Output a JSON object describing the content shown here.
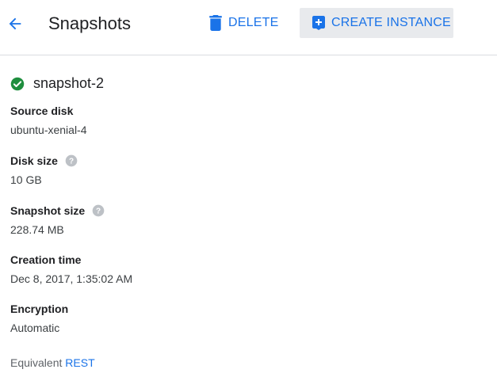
{
  "header": {
    "title": "Snapshots",
    "back_icon": "arrow-back-icon",
    "delete_label": "DELETE",
    "delete_icon": "trash-icon",
    "create_instance_label": "CREATE INSTANCE",
    "create_instance_icon": "add-box-icon"
  },
  "snapshot": {
    "name": "snapshot-2",
    "status_icon": "check-circle-icon",
    "status_color": "#1e8e3e"
  },
  "fields": {
    "source_disk": {
      "label": "Source disk",
      "value": "ubuntu-xenial-4"
    },
    "disk_size": {
      "label": "Disk size",
      "value": "10 GB"
    },
    "snapshot_size": {
      "label": "Snapshot size",
      "value": "228.74 MB"
    },
    "creation_time": {
      "label": "Creation time",
      "value": "Dec 8, 2017, 1:35:02 AM"
    },
    "encryption": {
      "label": "Encryption",
      "value": "Automatic"
    }
  },
  "footer": {
    "equivalent_label": "Equivalent",
    "rest_link": "REST"
  },
  "colors": {
    "accent": "#1a73e8",
    "button_bg": "#e8eaed",
    "help_icon": "#bdc1c6"
  }
}
